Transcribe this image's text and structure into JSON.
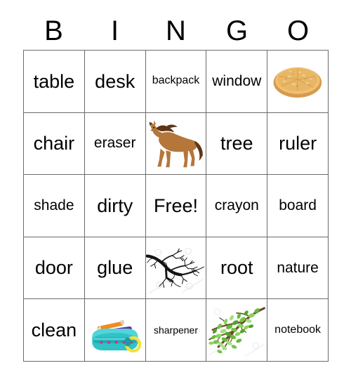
{
  "card": {
    "title": "BINGO card",
    "header_letters": [
      "B",
      "I",
      "N",
      "G",
      "O"
    ],
    "free_space_label": "Free!",
    "colors": {
      "grid_line": "#6b6b6b",
      "text": "#000000",
      "background": "#ffffff",
      "horse_body": "#b5763a",
      "horse_mane": "#5d3418",
      "pizza_crust": "#d89a4e",
      "pizza_cheese": "#f0c070",
      "branch_bare": "#141414",
      "branch_leaf_green": "#63bb35",
      "branch_wood": "#6b4226",
      "pencilcase_teal": "#2fc2c6",
      "pencilcase_star": "#e0218a",
      "pencilcase_handle": "#f5e03a",
      "pencil_orange": "#f08a22",
      "pencil_purple": "#6c2fa5"
    },
    "rows": [
      [
        {
          "type": "text",
          "value": "table",
          "size": "t-xl"
        },
        {
          "type": "text",
          "value": "desk",
          "size": "t-xl"
        },
        {
          "type": "text",
          "value": "backpack",
          "size": "t-sm"
        },
        {
          "type": "text",
          "value": "window",
          "size": "t-md"
        },
        {
          "type": "image",
          "value": "pizza-image",
          "alt": "pizza"
        }
      ],
      [
        {
          "type": "text",
          "value": "chair",
          "size": "t-xl"
        },
        {
          "type": "text",
          "value": "eraser",
          "size": "t-md"
        },
        {
          "type": "image",
          "value": "horse-image",
          "alt": "horse"
        },
        {
          "type": "text",
          "value": "tree",
          "size": "t-xl"
        },
        {
          "type": "text",
          "value": "ruler",
          "size": "t-xl"
        }
      ],
      [
        {
          "type": "text",
          "value": "shade",
          "size": "t-md"
        },
        {
          "type": "text",
          "value": "dirty",
          "size": "t-xl"
        },
        {
          "type": "text",
          "value": "Free!",
          "size": "t-xl"
        },
        {
          "type": "text",
          "value": "crayon",
          "size": "t-md"
        },
        {
          "type": "text",
          "value": "board",
          "size": "t-md"
        }
      ],
      [
        {
          "type": "text",
          "value": "door",
          "size": "t-xl"
        },
        {
          "type": "text",
          "value": "glue",
          "size": "t-xl"
        },
        {
          "type": "image",
          "value": "bare-branch-image",
          "alt": "bare branch"
        },
        {
          "type": "text",
          "value": "root",
          "size": "t-xl"
        },
        {
          "type": "text",
          "value": "nature",
          "size": "t-md"
        }
      ],
      [
        {
          "type": "text",
          "value": "clean",
          "size": "t-xl"
        },
        {
          "type": "image",
          "value": "pencil-case-image",
          "alt": "pencil case"
        },
        {
          "type": "text",
          "value": "sharpener",
          "size": "t-xs"
        },
        {
          "type": "image",
          "value": "leafy-branch-image",
          "alt": "leafy branch"
        },
        {
          "type": "text",
          "value": "notebook",
          "size": "t-sm"
        }
      ]
    ]
  }
}
